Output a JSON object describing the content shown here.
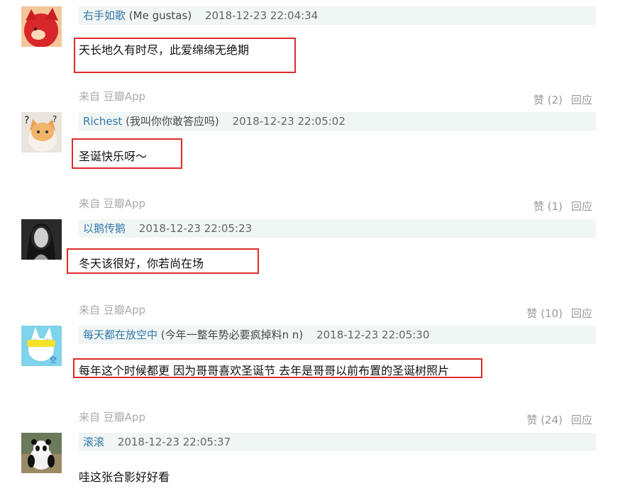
{
  "comments": [
    {
      "author": "右手如歌",
      "signature": "(Me gustas)",
      "time": "2018-12-23 22:04:34",
      "content": "天长地久有时尽，此爱绵绵无绝期",
      "source": "来自 豆瓣App",
      "likes": "赞 (2)",
      "reply": "回应"
    },
    {
      "author": "Richest",
      "signature": "(我叫你你敢答应吗)",
      "time": "2018-12-23 22:05:02",
      "content": "圣诞快乐呀～",
      "source": "来自 豆瓣App",
      "likes": "赞 (1)",
      "reply": "回应"
    },
    {
      "author": "以鹅传鹅",
      "signature": "",
      "time": "2018-12-23 22:05:23",
      "content": "冬天该很好，你若尚在场",
      "source": "来自 豆瓣App",
      "likes": "赞 (10)",
      "reply": "回应"
    },
    {
      "author": "每天都在放空中",
      "signature": "(今年一整年势必要疯掉料n n)",
      "time": "2018-12-23 22:05:30",
      "content": "每年这个时候都更 因为哥哥喜欢圣诞节 去年是哥哥以前布置的圣诞树照片",
      "source": "来自 豆瓣App",
      "likes": "赞 (24)",
      "reply": "回应"
    },
    {
      "author": "滚滚",
      "signature": "",
      "time": "2018-12-23 22:05:37",
      "content": "哇这张合影好好看"
    }
  ]
}
